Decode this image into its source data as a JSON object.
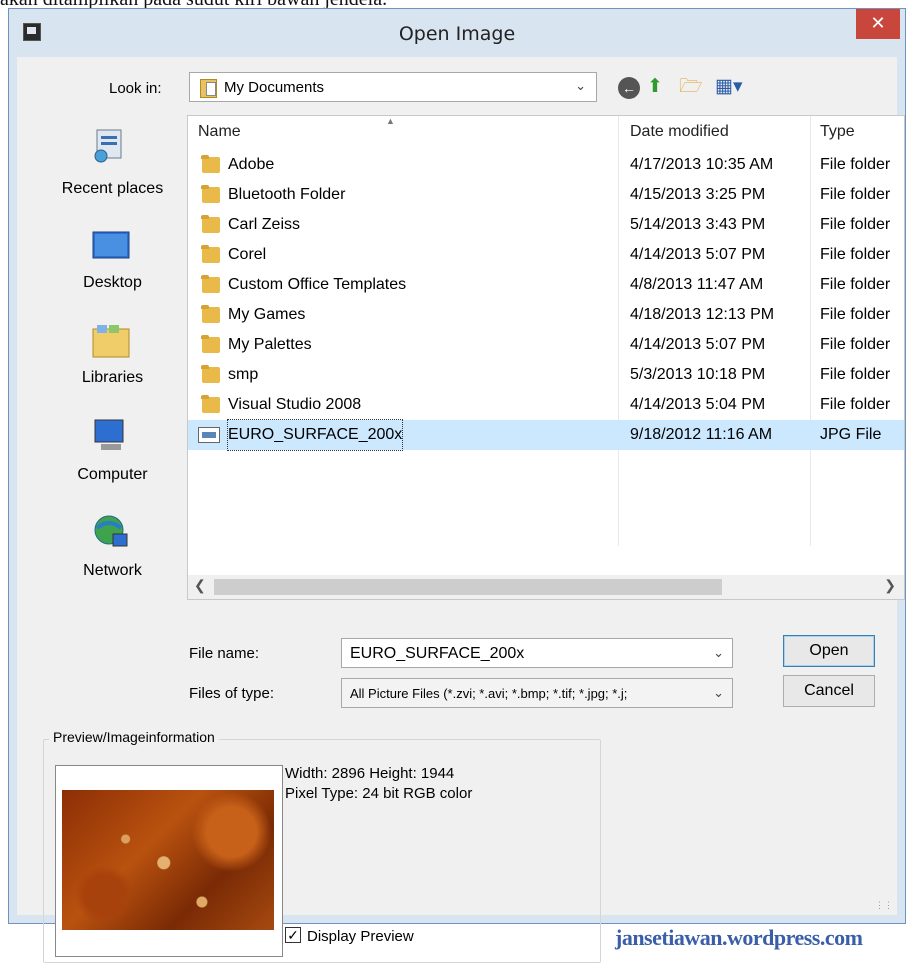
{
  "caption": "akan ditampilkan pada sudut kiri bawah jendela.",
  "window": {
    "title": "Open Image",
    "close_glyph": "✕"
  },
  "lookin": {
    "label": "Look in:",
    "value": "My Documents"
  },
  "toolbar": {
    "back": "back-icon",
    "up": "up-folder-icon",
    "new_folder": "new-folder-icon",
    "views": "views-menu-icon"
  },
  "places": [
    {
      "label": "Recent places",
      "icon": "recent-places-icon"
    },
    {
      "label": "Desktop",
      "icon": "desktop-icon"
    },
    {
      "label": "Libraries",
      "icon": "libraries-icon"
    },
    {
      "label": "Computer",
      "icon": "computer-icon"
    },
    {
      "label": "Network",
      "icon": "network-icon"
    }
  ],
  "columns": {
    "name": "Name",
    "date": "Date modified",
    "type": "Type"
  },
  "files": [
    {
      "name": "Adobe",
      "date": "4/17/2013 10:35 AM",
      "type": "File folder"
    },
    {
      "name": "Bluetooth Folder",
      "date": "4/15/2013 3:25 PM",
      "type": "File folder"
    },
    {
      "name": "Carl Zeiss",
      "date": "5/14/2013 3:43 PM",
      "type": "File folder"
    },
    {
      "name": "Corel",
      "date": "4/14/2013 5:07 PM",
      "type": "File folder"
    },
    {
      "name": "Custom Office Templates",
      "date": "4/8/2013 11:47 AM",
      "type": "File folder"
    },
    {
      "name": "My Games",
      "date": "4/18/2013 12:13 PM",
      "type": "File folder"
    },
    {
      "name": "My Palettes",
      "date": "4/14/2013 5:07 PM",
      "type": "File folder"
    },
    {
      "name": "smp",
      "date": "5/3/2013 10:18 PM",
      "type": "File folder"
    },
    {
      "name": "Visual Studio 2008",
      "date": "4/14/2013 5:04 PM",
      "type": "File folder"
    },
    {
      "name": "EURO_SURFACE_200x",
      "date": "9/18/2012 11:16 AM",
      "type": "JPG File"
    }
  ],
  "selected_index": 9,
  "form": {
    "file_name_label": "File name:",
    "file_name_value": "EURO_SURFACE_200x",
    "file_type_label": "Files of type:",
    "file_type_value": "All Picture Files (*.zvi; *.avi; *.bmp; *.tif; *.jpg; *.j;"
  },
  "buttons": {
    "open": "Open",
    "cancel": "Cancel"
  },
  "preview": {
    "legend": "Preview/Imageinformation",
    "width_height": "Width: 2896 Height: 1944",
    "pixel_type": "Pixel Type: 24 bit RGB color",
    "display_preview_label": "Display Preview",
    "display_preview_checked": true
  },
  "watermark": "jansetiawan.wordpress.com"
}
